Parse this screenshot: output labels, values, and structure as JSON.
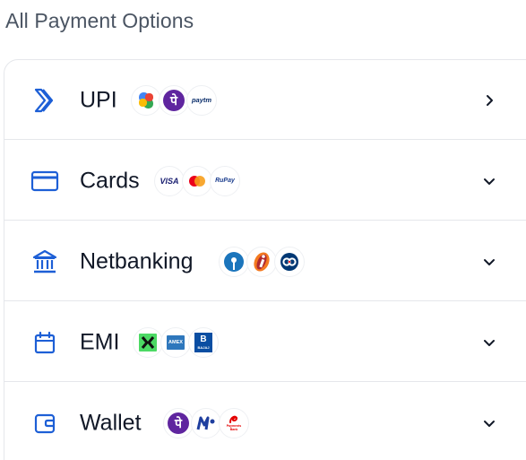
{
  "section_title": "All Payment Options",
  "accent_color": "#1d5fd6",
  "options": [
    {
      "label": "UPI",
      "icon": "upi-arrow-icon",
      "chevron": "chevron-right-icon",
      "logos": [
        {
          "name": "google-pay-logo"
        },
        {
          "name": "phonepe-logo"
        },
        {
          "name": "paytm-logo",
          "text": "paytm"
        }
      ]
    },
    {
      "label": "Cards",
      "icon": "card-icon",
      "chevron": "chevron-down-icon",
      "logos": [
        {
          "name": "visa-logo",
          "text": "VISA"
        },
        {
          "name": "mastercard-logo"
        },
        {
          "name": "rupay-logo",
          "text": "RuPay"
        }
      ]
    },
    {
      "label": "Netbanking",
      "icon": "bank-icon",
      "chevron": "chevron-down-icon",
      "logos": [
        {
          "name": "sbi-logo"
        },
        {
          "name": "icici-logo"
        },
        {
          "name": "kotak-logo"
        }
      ]
    },
    {
      "label": "EMI",
      "icon": "calendar-icon",
      "chevron": "chevron-down-icon",
      "logos": [
        {
          "name": "zestmoney-logo"
        },
        {
          "name": "amex-logo",
          "text": "AMEX"
        },
        {
          "name": "bajaj-finserv-logo",
          "text": "BAJAJ"
        }
      ]
    },
    {
      "label": "Wallet",
      "icon": "wallet-icon",
      "chevron": "chevron-down-icon",
      "logos": [
        {
          "name": "phonepe-logo"
        },
        {
          "name": "mobikwik-logo"
        },
        {
          "name": "airtel-payments-bank-logo",
          "text": "Payments Bank"
        }
      ]
    }
  ]
}
